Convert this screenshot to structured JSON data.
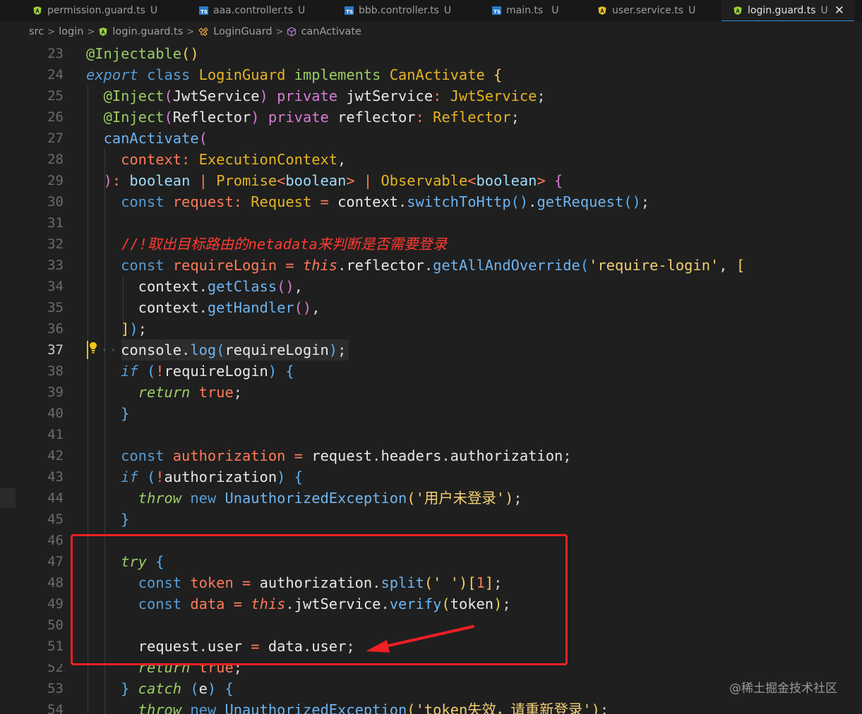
{
  "tabs": [
    {
      "name": "permission.guard.ts",
      "status": "U",
      "icon": "angular-icon"
    },
    {
      "name": "aaa.controller.ts",
      "status": "U",
      "icon": "ts-icon"
    },
    {
      "name": "bbb.controller.ts",
      "status": "U",
      "icon": "ts-icon"
    },
    {
      "name": "main.ts",
      "status": "U",
      "icon": "ts-icon"
    },
    {
      "name": "user.service.ts",
      "status": "U",
      "icon": "angular-icon"
    },
    {
      "name": "login.guard.ts",
      "status": "U",
      "icon": "angular-icon",
      "active": true
    }
  ],
  "close_glyph": "✕",
  "breadcrumb": [
    "src",
    "login",
    "login.guard.ts",
    "LoginGuard",
    "canActivate"
  ],
  "editor": {
    "current_line": 37,
    "lines": [
      {
        "n": "23",
        "t": "@Injectable()"
      },
      {
        "n": "24",
        "t": "export class LoginGuard implements CanActivate {"
      },
      {
        "n": "25",
        "t": "  @Inject(JwtService) private jwtService: JwtService;"
      },
      {
        "n": "26",
        "t": "  @Inject(Reflector) private reflector: Reflector;"
      },
      {
        "n": "27",
        "t": "  canActivate("
      },
      {
        "n": "28",
        "t": "    context: ExecutionContext,"
      },
      {
        "n": "29",
        "t": "  ): boolean | Promise<boolean> | Observable<boolean> {"
      },
      {
        "n": "30",
        "t": "    const request: Request = context.switchToHttp().getRequest();"
      },
      {
        "n": "31",
        "t": ""
      },
      {
        "n": "32",
        "t": "    //!取出目标路由的netadata来判断是否需要登录"
      },
      {
        "n": "33",
        "t": "    const requireLogin = this.reflector.getAllAndOverride('require-login', ["
      },
      {
        "n": "34",
        "t": "      context.getClass(),"
      },
      {
        "n": "35",
        "t": "      context.getHandler(),"
      },
      {
        "n": "36",
        "t": "    ]);"
      },
      {
        "n": "37",
        "t": "    console.log(requireLogin);"
      },
      {
        "n": "38",
        "t": "    if (!requireLogin) {"
      },
      {
        "n": "39",
        "t": "      return true;"
      },
      {
        "n": "40",
        "t": "    }"
      },
      {
        "n": "41",
        "t": ""
      },
      {
        "n": "42",
        "t": "    const authorization = request.headers.authorization;"
      },
      {
        "n": "43",
        "t": "    if (!authorization) {"
      },
      {
        "n": "44",
        "t": "      throw new UnauthorizedException('用户未登录');"
      },
      {
        "n": "45",
        "t": "    }"
      },
      {
        "n": "46",
        "t": ""
      },
      {
        "n": "47",
        "t": "    try {"
      },
      {
        "n": "48",
        "t": "      const token = authorization.split(' ')[1];"
      },
      {
        "n": "49",
        "t": "      const data = this.jwtService.verify(token);"
      },
      {
        "n": "50",
        "t": ""
      },
      {
        "n": "51",
        "t": "      request.user = data.user;"
      },
      {
        "n": "52",
        "t": "      return true;"
      },
      {
        "n": "53",
        "t": "    } catch (e) {"
      },
      {
        "n": "54",
        "t": "      throw new UnauthorizedException('token失效，请重新登录');"
      }
    ]
  },
  "watermark": "@稀土掘金技术社区",
  "colors": {
    "highlight_box": "#ee1f25",
    "active_tab_border": "#2a8dd8",
    "editor_bg": "#1f1f1f"
  }
}
